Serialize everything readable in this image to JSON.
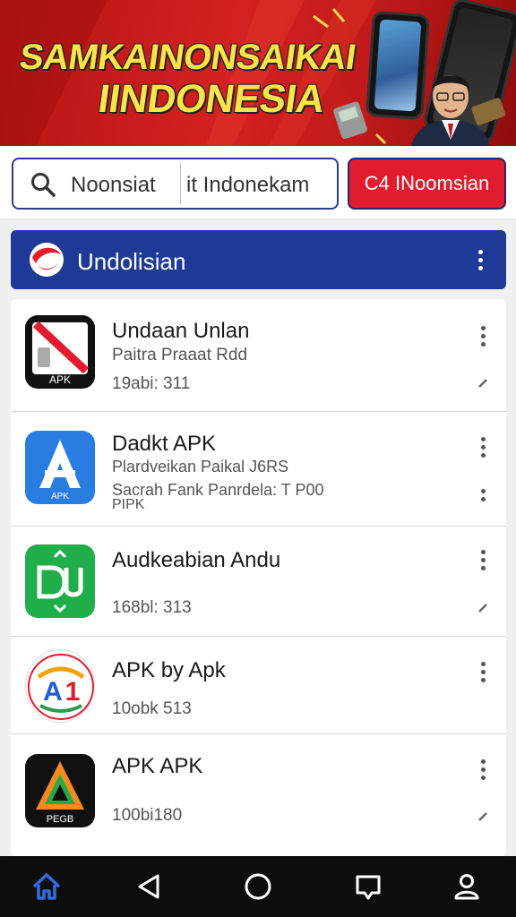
{
  "banner": {
    "title_line1": "SAMKAINONSAIKAI",
    "title_line2": "IINDONESIA"
  },
  "search": {
    "field_text_left": "Noonsiat",
    "field_text_right": "it Indonekam",
    "button_label": "C4 INoomsian"
  },
  "section": {
    "title": "Undolisian"
  },
  "apps": [
    {
      "name": "Undaan Unlan",
      "subtitle": "Paitra Praaat Rdd",
      "meta": "19abi: 311",
      "icon": "apk-red-slash-icon"
    },
    {
      "name": "Dadkt APK",
      "subtitle": "Plardveikan Paikal J6RS",
      "subtitle2": "Sacrah Fank Panrdela: T P00",
      "subtitle3": "PIPK",
      "meta": "",
      "icon": "apk-blue-a-icon"
    },
    {
      "name": "Audkeabian Andu",
      "subtitle": "",
      "meta": "168bl: 313",
      "icon": "apk-green-du-icon"
    },
    {
      "name": "APK by Apk",
      "subtitle": "",
      "meta": "10obk 513",
      "icon": "apk-a1-badge-icon"
    },
    {
      "name": "APK APK",
      "subtitle": "",
      "meta": "100bi180",
      "icon": "apk-triangle-icon"
    }
  ],
  "bottom_nav": {
    "items": [
      "home-icon",
      "back-icon",
      "circle-home-icon",
      "recents-icon",
      "profile-icon"
    ]
  },
  "colors": {
    "banner_red": "#c81c1c",
    "header_blue": "#1f3a96",
    "search_button_red": "#e31b2e",
    "nav_active": "#2f6fe0"
  }
}
